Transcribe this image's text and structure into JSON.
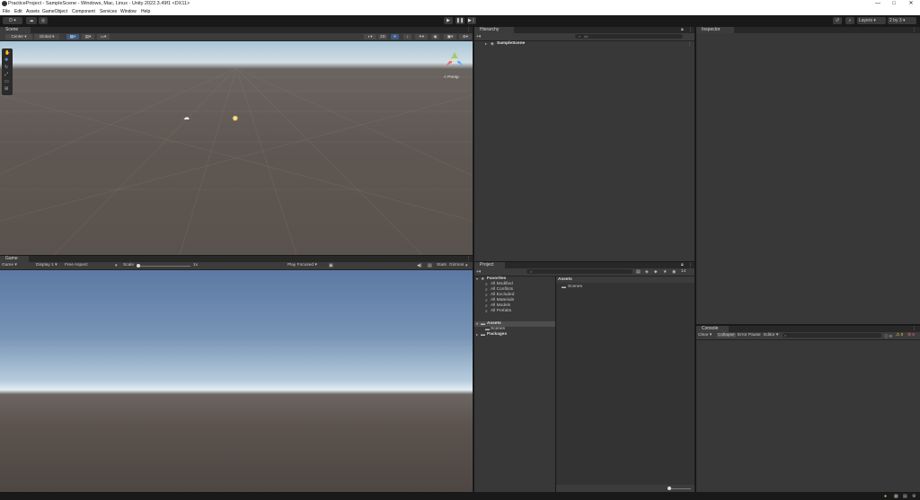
{
  "window": {
    "title": "PracticeProject - SampleScene - Windows, Mac, Linux - Unity 2022.3.49f1 <DX11>",
    "controls": [
      "—",
      "□",
      "✕"
    ]
  },
  "menu": [
    "File",
    "Edit",
    "Assets",
    "GameObject",
    "Component",
    "Services",
    "Window",
    "Help"
  ],
  "toolbar": {
    "account_label": "D",
    "layers_label": "Layers",
    "layout_label": "2 by 3"
  },
  "scene": {
    "tab_label": "Scene",
    "center_label": "Center",
    "global_label": "Global",
    "mode_2d": "2D",
    "persp_label": "< Persp"
  },
  "game": {
    "tab_label": "Game",
    "mode_label": "Game",
    "display_label": "Display 1",
    "aspect_label": "Free Aspect",
    "scale_label": "Scale",
    "scale_value": "1x",
    "play_focused_label": "Play Focused",
    "stats_label": "Stats",
    "gizmos_label": "Gizmos"
  },
  "hierarchy": {
    "tab_label": "Hierarchy",
    "search_placeholder": "All",
    "scene_item": "SampleScene"
  },
  "inspector": {
    "tab_label": "Inspector"
  },
  "project": {
    "tab_label": "Project",
    "favorites_label": "Favorites",
    "favorites": [
      "All Modified",
      "All Conflicts",
      "All Excluded",
      "All Materials",
      "All Models",
      "All Prefabs"
    ],
    "assets_label": "Assets",
    "assets_children": [
      "Scenes"
    ],
    "packages_label": "Packages",
    "breadcrumb": "Assets",
    "content_items": [
      "Scenes"
    ],
    "badge_count": "14"
  },
  "console": {
    "tab_label": "Console",
    "clear_label": "Clear",
    "collapse_label": "Collapse",
    "error_pause_label": "Error Pause",
    "editor_label": "Editor",
    "counts": [
      "0",
      "0",
      "0"
    ]
  }
}
